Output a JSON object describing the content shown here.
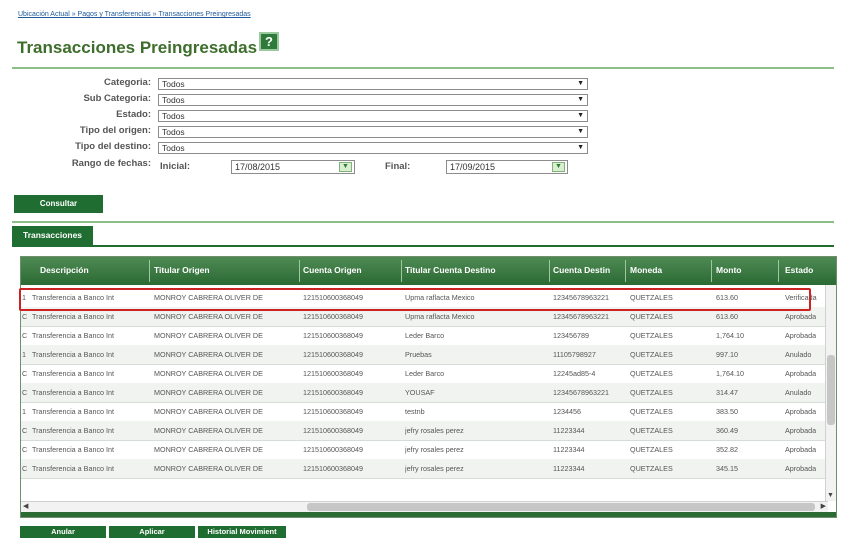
{
  "breadcrumb": "Ubicación Actual » Pagos y Transferencias » Transacciones Preingresadas",
  "page_title": "Transacciones Preingresadas",
  "help_icon": "?",
  "filters": {
    "categoria": {
      "label": "Categoria:",
      "value": "Todos"
    },
    "sub_categoria": {
      "label": "Sub Categoria:",
      "value": "Todos"
    },
    "estado": {
      "label": "Estado:",
      "value": "Todos"
    },
    "tipo_origen": {
      "label": "Tipo del origen:",
      "value": "Todos"
    },
    "tipo_destino": {
      "label": "Tipo del destino:",
      "value": "Todos"
    },
    "rango": {
      "label": "Rango de fechas:",
      "inicial_label": "Inicial:",
      "inicial_value": "17/08/2015",
      "final_label": "Final:",
      "final_value": "17/09/2015"
    }
  },
  "consultar_label": "Consultar",
  "tab_label": "Transacciones",
  "columns": [
    "Descripción",
    "Titular Origen",
    "Cuenta Origen",
    "Titular Cuenta Destino",
    "Cuenta Destin",
    "Moneda",
    "Monto",
    "Estado"
  ],
  "rows": [
    [
      "1",
      "Transferencia a Banco Int",
      "MONROY CABRERA OLIVER DE",
      "121510600368049",
      "Upma raflacta Mexico",
      "12345678963221",
      "QUETZALES",
      "613.60",
      "Verificada"
    ],
    [
      "C",
      "Transferencia a Banco Int",
      "MONROY CABRERA OLIVER DE",
      "121510600368049",
      "Upma raflacta Mexico",
      "12345678963221",
      "QUETZALES",
      "613.60",
      "Aprobada"
    ],
    [
      "C",
      "Transferencia a Banco Int",
      "MONROY CABRERA OLIVER DE",
      "121510600368049",
      "Leder Barco",
      "123456789",
      "QUETZALES",
      "1,764.10",
      "Aprobada"
    ],
    [
      "1",
      "Transferencia a Banco Int",
      "MONROY CABRERA OLIVER DE",
      "121510600368049",
      "Pruebas",
      "11105798927",
      "QUETZALES",
      "997.10",
      "Anulado"
    ],
    [
      "C",
      "Transferencia a Banco Int",
      "MONROY CABRERA OLIVER DE",
      "121510600368049",
      "Leder Barco",
      "12245ad85-4",
      "QUETZALES",
      "1,764.10",
      "Aprobada"
    ],
    [
      "C",
      "Transferencia a Banco Int",
      "MONROY CABRERA OLIVER DE",
      "121510600368049",
      "YOUSAF",
      "12345678963221",
      "QUETZALES",
      "314.47",
      "Anulado"
    ],
    [
      "1",
      "Transferencia a Banco Int",
      "MONROY CABRERA OLIVER DE",
      "121510600368049",
      "testnb",
      "1234456",
      "QUETZALES",
      "383.50",
      "Aprobada"
    ],
    [
      "C",
      "Transferencia a Banco Int",
      "MONROY CABRERA OLIVER DE",
      "121510600368049",
      "jefry rosales perez",
      "11223344",
      "QUETZALES",
      "360.49",
      "Aprobada"
    ],
    [
      "C",
      "Transferencia a Banco Int",
      "MONROY CABRERA OLIVER DE",
      "121510600368049",
      "jefry rosales perez",
      "11223344",
      "QUETZALES",
      "352.82",
      "Aprobada"
    ],
    [
      "C",
      "Transferencia a Banco Int",
      "MONROY CABRERA OLIVER DE",
      "121510600368049",
      "jefry rosales perez",
      "11223344",
      "QUETZALES",
      "345.15",
      "Aprobada"
    ]
  ],
  "actions": {
    "anular": "Anular",
    "aplicar": "Aplicar",
    "historial": "Historial Movimient"
  }
}
